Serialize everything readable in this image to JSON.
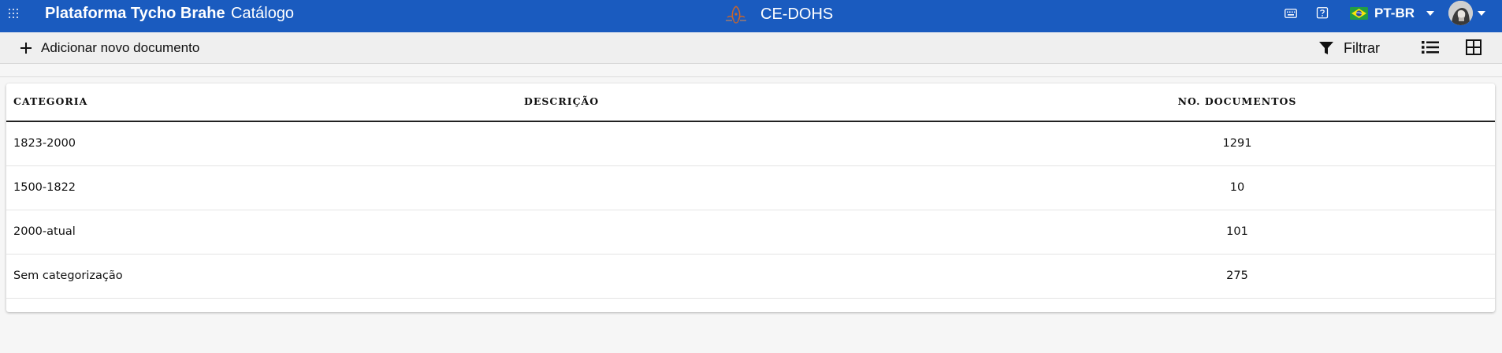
{
  "header": {
    "brand": "Plataforma Tycho Brahe",
    "section": "Catálogo",
    "corpus_title": "CE-DOHS",
    "language": "PT-BR",
    "accent_color": "#1a5bbf",
    "icons": [
      "apps-grid-icon",
      "corpus-logo-icon",
      "keyboard-icon",
      "help-icon",
      "brazil-flag-icon",
      "chevron-down-icon",
      "avatar"
    ]
  },
  "toolbar": {
    "add_label": "Adicionar novo documento",
    "filter_label": "Filtrar",
    "icons": [
      "plus-icon",
      "filter-icon",
      "list-view-icon",
      "grid-view-icon"
    ]
  },
  "table": {
    "columns": [
      "CATEGORIA",
      "DESCRIÇÃO",
      "NO. DOCUMENTOS"
    ],
    "rows": [
      {
        "categoria": "1823-2000",
        "descricao": "",
        "documentos": "1291"
      },
      {
        "categoria": "1500-1822",
        "descricao": "",
        "documentos": "10"
      },
      {
        "categoria": "2000-atual",
        "descricao": "",
        "documentos": "101"
      },
      {
        "categoria": "Sem categorização",
        "descricao": "",
        "documentos": "275"
      }
    ]
  }
}
